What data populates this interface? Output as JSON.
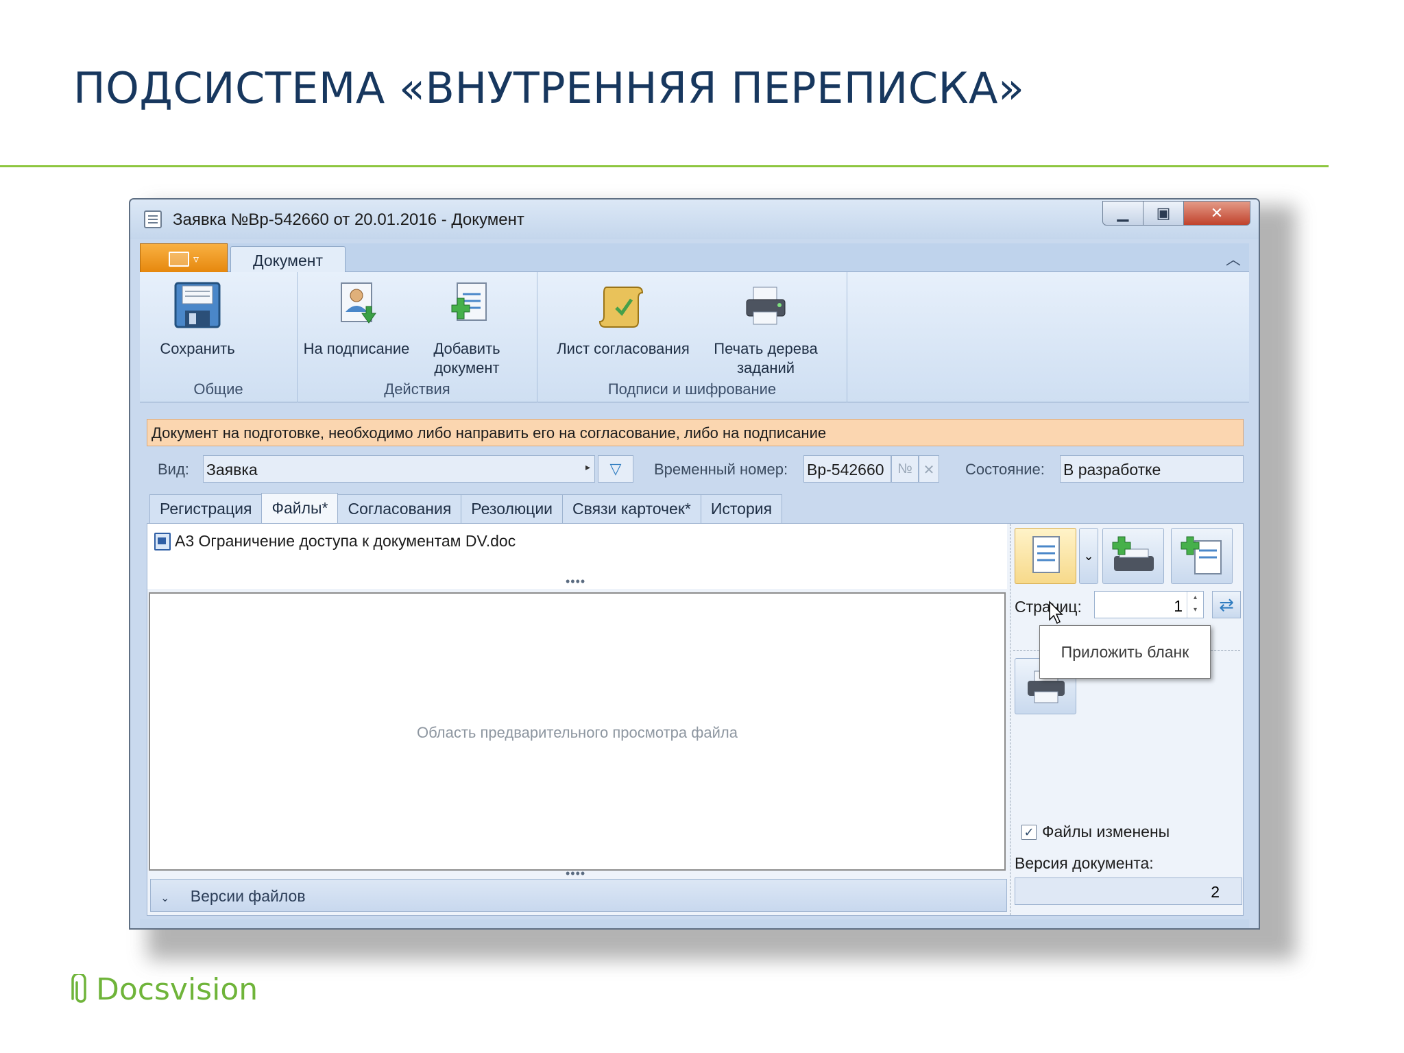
{
  "slide": {
    "title": "ПОДСИСТЕМА «ВНУТРЕННЯЯ ПЕРЕПИСКА»",
    "brand": "Docsvision",
    "accent_color": "#8dc63f",
    "title_color": "#17375e"
  },
  "window": {
    "title": "Заявка №Вр-542660 от 20.01.2016 - Документ",
    "controls": [
      "minimize-icon",
      "maximize-icon",
      "close-icon"
    ]
  },
  "ribbon": {
    "tab": "Документ",
    "groups": [
      {
        "label": "Общие",
        "buttons": [
          "Сохранить"
        ]
      },
      {
        "label": "Действия",
        "buttons": [
          "На подписание",
          "Добавить документ"
        ]
      },
      {
        "label": "Подписи и шифрование",
        "buttons": [
          "Лист согласования",
          "Печать дерева заданий"
        ]
      }
    ],
    "save": "Сохранить",
    "to_sign": "На подписание",
    "add_doc": "Добавить документ",
    "approval_sheet": "Лист согласования",
    "print_tree": "Печать дерева заданий",
    "group_general": "Общие",
    "group_actions": "Действия",
    "group_signs": "Подписи и шифрование"
  },
  "message": "Документ на подготовке, необходимо либо направить его на согласование, либо на подписание",
  "fields": {
    "kind_label": "Вид:",
    "kind_value": "Заявка",
    "temp_number_label": "Временный номер:",
    "temp_number_value": "Вр-542660",
    "number_placeholder": "№",
    "state_label": "Состояние:",
    "state_value": "В разработке"
  },
  "tabs": [
    "Регистрация",
    "Файлы*",
    "Согласования",
    "Резолюции",
    "Связи карточек*",
    "История"
  ],
  "active_tab": "Файлы*",
  "files": {
    "items": [
      "А3 Ограничение доступа к документам DV.doc"
    ],
    "preview_placeholder": "Область предварительного просмотра файла",
    "versions_label": "Версии файлов",
    "pages_label": "Страниц:",
    "pages_value": "1",
    "tooltip": "Приложить бланк",
    "files_changed_label": "Файлы изменены",
    "files_changed_checked": true,
    "doc_version_label": "Версия документа:",
    "doc_version_value": "2"
  }
}
